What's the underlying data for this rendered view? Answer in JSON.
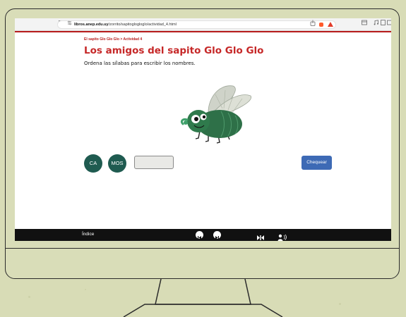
{
  "browser": {
    "url_host": "libros.anep.edu.uy",
    "url_path": "/zorrito/sapitoglogloglo/actividad_4.html"
  },
  "page": {
    "breadcrumb": "El sapito Glo Glo Glo > Actividad 4",
    "title": "Los amigos del sapito Glo Glo Glo",
    "instructions": "Ordena las sílabas para escribir los nombres."
  },
  "syllables": [
    "CA",
    "MOS"
  ],
  "answer": {
    "value": ""
  },
  "check_button": {
    "label": "Chequear"
  },
  "toolbar": {
    "index_label": "Índice"
  },
  "colors": {
    "accent_red": "#c62828",
    "syllable_green": "#1f5b50",
    "button_blue": "#3d6ab5",
    "fly_green": "#2e7048"
  },
  "icons": [
    "sidebar-icon",
    "site-settings-icon",
    "share-icon",
    "brave-shield-icon",
    "prev-page-icon",
    "next-page-icon",
    "bookmark-icon",
    "audio-icon"
  ]
}
